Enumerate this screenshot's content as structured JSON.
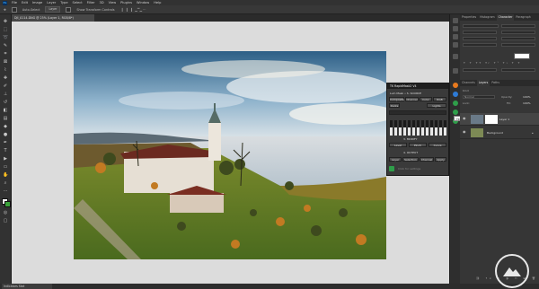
{
  "menu": {
    "logo": "Ps",
    "items": [
      "File",
      "Edit",
      "Image",
      "Layer",
      "Type",
      "Select",
      "Filter",
      "3D",
      "View",
      "Plugins",
      "Window",
      "Help"
    ]
  },
  "options": {
    "sample_label": "Auto-Select",
    "sample_value": "Layer",
    "show_transform": "Show Transform Controls"
  },
  "document": {
    "tab_title": "DJI_0114.DNG @ 25% (Layer 1, RGB/8*)"
  },
  "status": {
    "left_text": "Indicators Stat"
  },
  "right_panel": {
    "top_tabs": [
      "Properties",
      "Histogram",
      "Character",
      "Paragraph"
    ],
    "active_top_tab": "Character",
    "layer_tabs": [
      "Channels",
      "Layers",
      "Paths"
    ],
    "active_layer_tab": "Layers",
    "kind_label": "Kind",
    "blend_mode": "Normal",
    "opacity_label": "Opacity:",
    "opacity_value": "100%",
    "lock_label": "Lock:",
    "fill_label": "Fill:",
    "fill_value": "100%",
    "layers": [
      {
        "name": "Layer 1"
      },
      {
        "name": "Background"
      }
    ]
  },
  "plugin": {
    "title": "TK RapidMask2 V4",
    "source_label": "Lum Mask • S. SOURCE",
    "tabs": [
      "Composite",
      "Channel",
      "Color",
      "RGB"
    ],
    "lights_label": "Lights",
    "darks_label": "Darks",
    "modify_label": "3. MODIFY",
    "output_label": "4. OUTPUT",
    "buttons": [
      "Level",
      "Pinch",
      "Curve"
    ],
    "output_buttons": [
      "Layer",
      "Selection",
      "Channel",
      "Apply"
    ],
    "footer": "Click for settings"
  },
  "tooltip": "TK RapidMask2 V4",
  "colors": {
    "accent": "#31a8ff",
    "canvas": "#dcdcdc",
    "panel": "#363636",
    "foreground_swatch": "#ffffff",
    "background_swatch": "#3aa23a"
  }
}
